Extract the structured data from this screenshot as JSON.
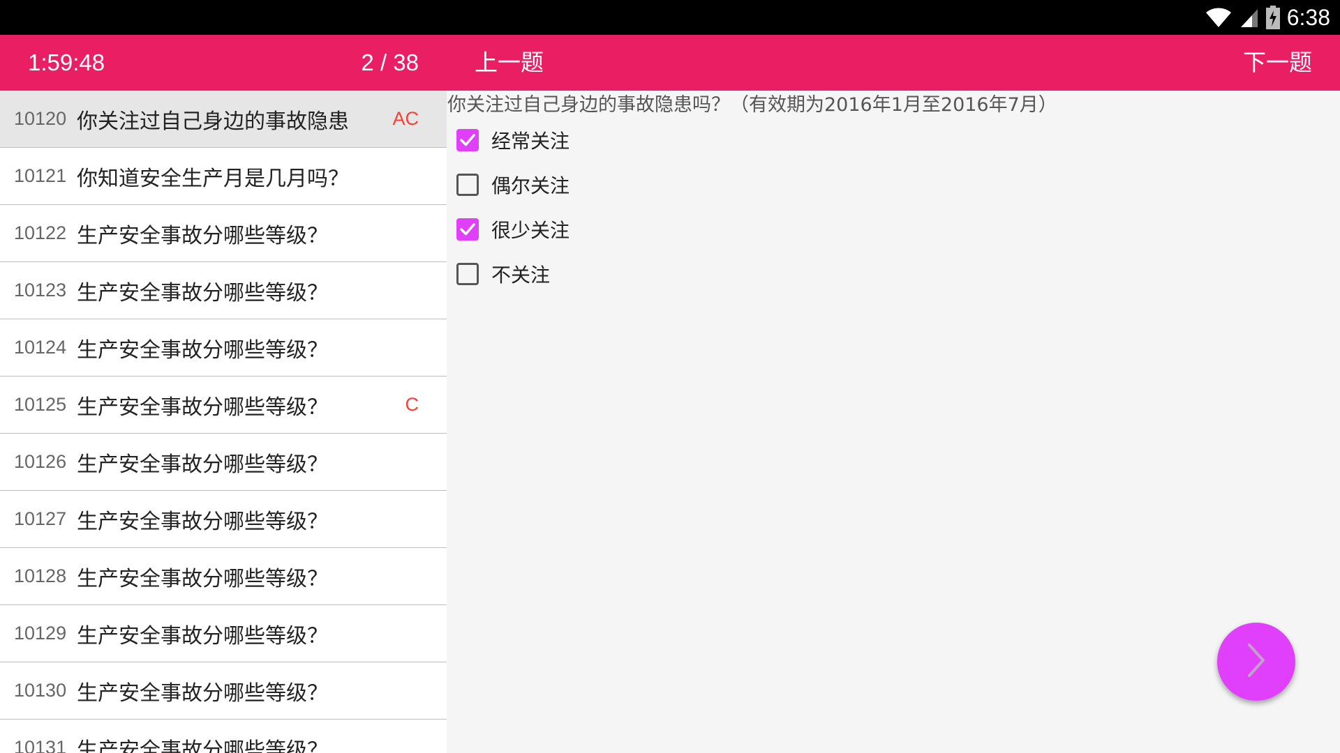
{
  "statusbar": {
    "time": "6:38"
  },
  "header": {
    "timer": "1:59:48",
    "progress": "2 / 38",
    "prev_label": "上一题",
    "next_label": "下一题"
  },
  "questions": [
    {
      "id": "10120",
      "text": "你关注过自己身边的事故隐患",
      "mark": "AC",
      "selected": true
    },
    {
      "id": "10121",
      "text": "你知道安全生产月是几月吗？",
      "mark": ""
    },
    {
      "id": "10122",
      "text": "生产安全事故分哪些等级？",
      "mark": ""
    },
    {
      "id": "10123",
      "text": "生产安全事故分哪些等级？",
      "mark": ""
    },
    {
      "id": "10124",
      "text": "生产安全事故分哪些等级？",
      "mark": ""
    },
    {
      "id": "10125",
      "text": "生产安全事故分哪些等级？",
      "mark": "C"
    },
    {
      "id": "10126",
      "text": "生产安全事故分哪些等级？",
      "mark": ""
    },
    {
      "id": "10127",
      "text": "生产安全事故分哪些等级？",
      "mark": ""
    },
    {
      "id": "10128",
      "text": "生产安全事故分哪些等级？",
      "mark": ""
    },
    {
      "id": "10129",
      "text": "生产安全事故分哪些等级？",
      "mark": ""
    },
    {
      "id": "10130",
      "text": "生产安全事故分哪些等级？",
      "mark": ""
    },
    {
      "id": "10131",
      "text": "生产安全事故分哪些等级？",
      "mark": ""
    }
  ],
  "current_question": {
    "text": "你关注过自己身边的事故隐患吗？（有效期为2016年1月至2016年7月）",
    "options": [
      {
        "label": "经常关注",
        "checked": true
      },
      {
        "label": "偶尔关注",
        "checked": false
      },
      {
        "label": "很少关注",
        "checked": true
      },
      {
        "label": "不关注",
        "checked": false
      }
    ]
  },
  "colors": {
    "appbar": "#E91E63",
    "accent": "#E040FB",
    "mark": "#f44336"
  },
  "icons": {
    "fab": "chevron-right-icon",
    "status": [
      "wifi-icon",
      "signal-icon",
      "battery-charging-icon"
    ]
  }
}
